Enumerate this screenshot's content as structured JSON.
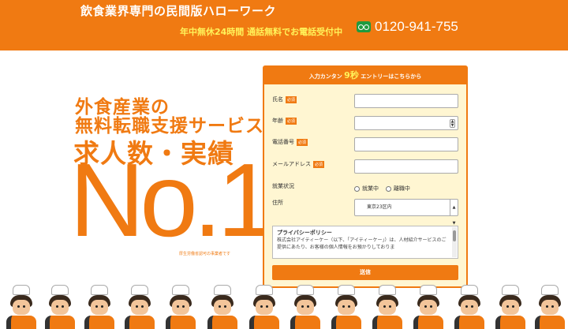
{
  "header": {
    "title": "飲食業界専門の民間版ハローワーク",
    "hours": "年中無休24時間 通話無料でお電話受付中",
    "phone": "0120-941-755"
  },
  "hero": {
    "line1": "外食産業の",
    "line2": "無料転職支援サービス",
    "line3": "求人数・実績",
    "rank": "No.1",
    "license": "厚生労働省認可の事業者です"
  },
  "form": {
    "header_before": "入力カンタン",
    "header_highlight": "9秒",
    "header_after": "エントリーはこちらから",
    "required": "必須",
    "labels": {
      "name": "氏名",
      "age": "年齢",
      "phone": "電話番号",
      "email": "メールアドレス",
      "status": "就業状況",
      "address": "住所"
    },
    "status_options": [
      "就業中",
      "離職中"
    ],
    "address_value": "東京23区内",
    "policy_title": "プライバシーポリシー",
    "policy_text": "株式会社アイティーケー（以下、「アイティーケー」）は、人材紹介サービスのご提供にあたり、お客様の個人情報をお預かりしておりま",
    "submit": "送信"
  },
  "colors": {
    "brand": "#f07a12",
    "phone_icon": "#1f9a3e",
    "highlight": "#fff35a"
  },
  "icons": {
    "phone": "free-dial-icon",
    "select": "select-arrow-icon"
  }
}
